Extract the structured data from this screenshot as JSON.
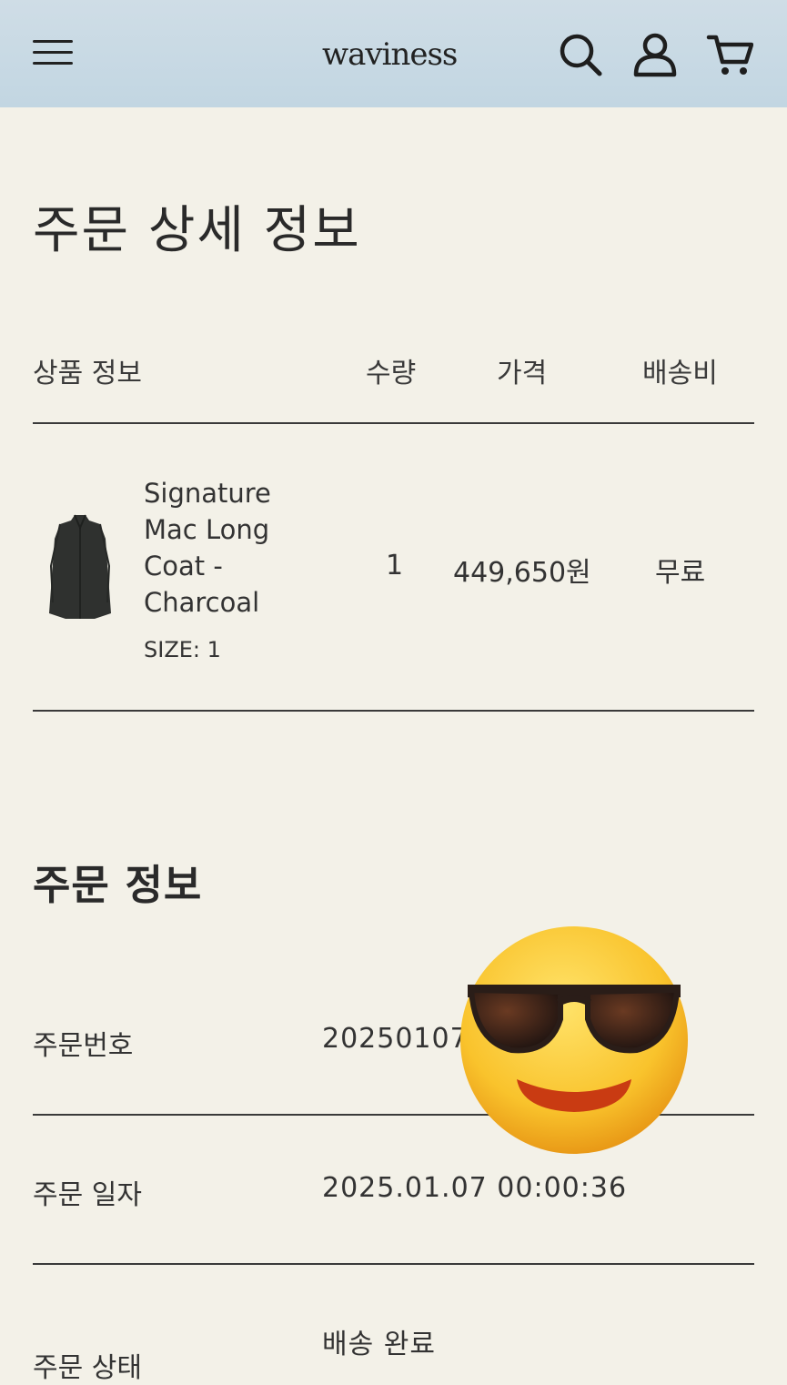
{
  "header": {
    "brand": "waviness",
    "icons": [
      "menu-icon",
      "search-icon",
      "user-icon",
      "cart-icon"
    ]
  },
  "page": {
    "title": "주문 상세 정보"
  },
  "table": {
    "columns": [
      "상품 정보",
      "수량",
      "가격",
      "배송비"
    ],
    "rows": [
      {
        "name_lines": [
          "Signature",
          "Mac Long",
          "Coat -",
          "Charcoal"
        ],
        "size": "SIZE: 1",
        "quantity": "1",
        "price": "449,650원",
        "shipping": "무료"
      }
    ]
  },
  "order_info": {
    "title": "주문 정보",
    "rows": [
      {
        "label": "주문번호",
        "value": "20250107"
      },
      {
        "label": "주문 일자",
        "value": "2025.01.07 00:00:36"
      },
      {
        "label": "주문 상태",
        "value": "배송 완료"
      }
    ]
  },
  "colors": {
    "header_bg": "#c6d9e4",
    "page_bg": "#f3f1e8",
    "text": "#2b2b2b"
  }
}
